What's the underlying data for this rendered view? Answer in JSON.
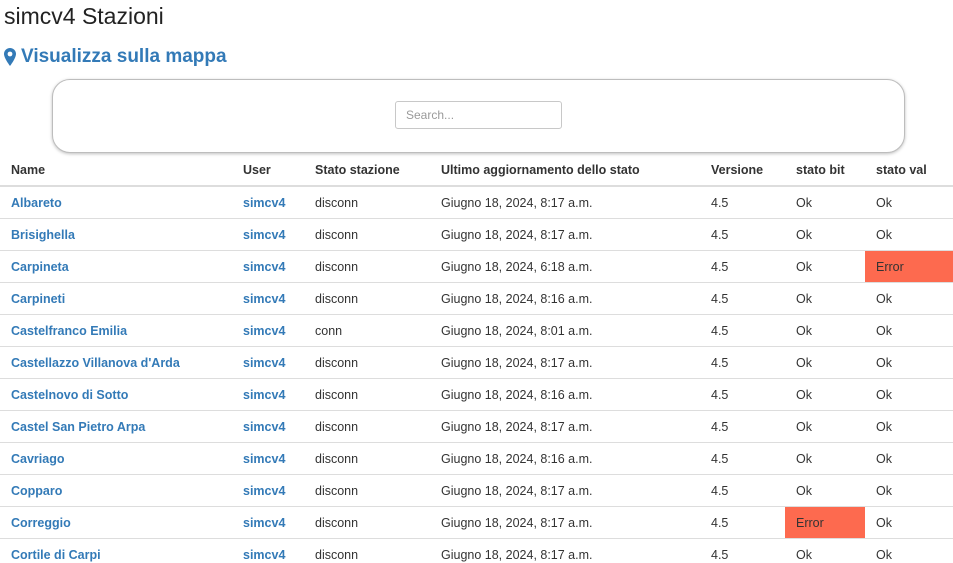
{
  "page": {
    "title": "simcv4 Stazioni",
    "map_link": "Visualizza sulla mappa",
    "map_link_icon": "map-marker-icon",
    "accent_color": "#337ab7",
    "error_color": "#fd6a4f"
  },
  "search": {
    "placeholder": "Search...",
    "value": ""
  },
  "table": {
    "headers": {
      "name": "Name",
      "user": "User",
      "stato": "Stato stazione",
      "ultimo": "Ultimo aggiornamento dello stato",
      "versione": "Versione",
      "stato_bit": "stato bit",
      "stato_val": "stato val"
    },
    "rows": [
      {
        "name": "Albareto",
        "user": "simcv4",
        "stato": "disconn",
        "ultimo": "Giugno 18, 2024, 8:17 a.m.",
        "versione": "4.5",
        "bit": "Ok",
        "val": "Ok",
        "bit_error": false,
        "val_error": false
      },
      {
        "name": "Brisighella",
        "user": "simcv4",
        "stato": "disconn",
        "ultimo": "Giugno 18, 2024, 8:17 a.m.",
        "versione": "4.5",
        "bit": "Ok",
        "val": "Ok",
        "bit_error": false,
        "val_error": false
      },
      {
        "name": "Carpineta",
        "user": "simcv4",
        "stato": "disconn",
        "ultimo": "Giugno 18, 2024, 6:18 a.m.",
        "versione": "4.5",
        "bit": "Ok",
        "val": "Error",
        "bit_error": false,
        "val_error": true
      },
      {
        "name": "Carpineti",
        "user": "simcv4",
        "stato": "disconn",
        "ultimo": "Giugno 18, 2024, 8:16 a.m.",
        "versione": "4.5",
        "bit": "Ok",
        "val": "Ok",
        "bit_error": false,
        "val_error": false
      },
      {
        "name": "Castelfranco Emilia",
        "user": "simcv4",
        "stato": "conn",
        "ultimo": "Giugno 18, 2024, 8:01 a.m.",
        "versione": "4.5",
        "bit": "Ok",
        "val": "Ok",
        "bit_error": false,
        "val_error": false
      },
      {
        "name": "Castellazzo Villanova d'Arda",
        "user": "simcv4",
        "stato": "disconn",
        "ultimo": "Giugno 18, 2024, 8:17 a.m.",
        "versione": "4.5",
        "bit": "Ok",
        "val": "Ok",
        "bit_error": false,
        "val_error": false
      },
      {
        "name": "Castelnovo di Sotto",
        "user": "simcv4",
        "stato": "disconn",
        "ultimo": "Giugno 18, 2024, 8:16 a.m.",
        "versione": "4.5",
        "bit": "Ok",
        "val": "Ok",
        "bit_error": false,
        "val_error": false
      },
      {
        "name": "Castel San Pietro Arpa",
        "user": "simcv4",
        "stato": "disconn",
        "ultimo": "Giugno 18, 2024, 8:17 a.m.",
        "versione": "4.5",
        "bit": "Ok",
        "val": "Ok",
        "bit_error": false,
        "val_error": false
      },
      {
        "name": "Cavriago",
        "user": "simcv4",
        "stato": "disconn",
        "ultimo": "Giugno 18, 2024, 8:16 a.m.",
        "versione": "4.5",
        "bit": "Ok",
        "val": "Ok",
        "bit_error": false,
        "val_error": false
      },
      {
        "name": "Copparo",
        "user": "simcv4",
        "stato": "disconn",
        "ultimo": "Giugno 18, 2024, 8:17 a.m.",
        "versione": "4.5",
        "bit": "Ok",
        "val": "Ok",
        "bit_error": false,
        "val_error": false
      },
      {
        "name": "Correggio",
        "user": "simcv4",
        "stato": "disconn",
        "ultimo": "Giugno 18, 2024, 8:17 a.m.",
        "versione": "4.5",
        "bit": "Error",
        "val": "Ok",
        "bit_error": true,
        "val_error": false
      },
      {
        "name": "Cortile di Carpi",
        "user": "simcv4",
        "stato": "disconn",
        "ultimo": "Giugno 18, 2024, 8:17 a.m.",
        "versione": "4.5",
        "bit": "Ok",
        "val": "Ok",
        "bit_error": false,
        "val_error": false
      }
    ]
  }
}
